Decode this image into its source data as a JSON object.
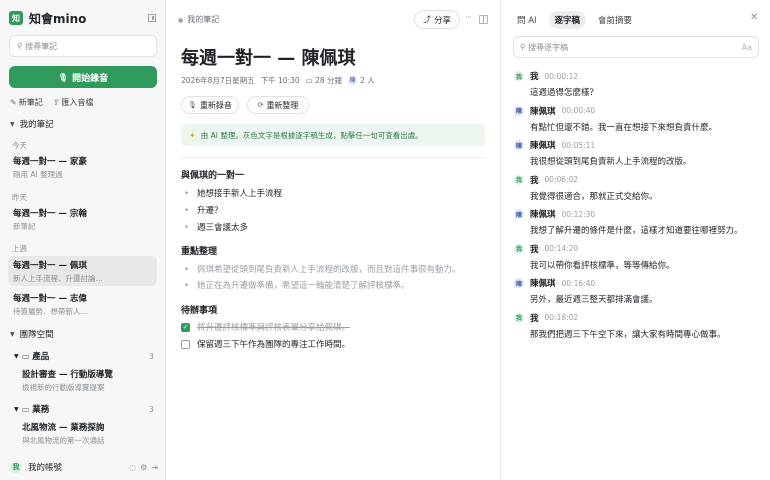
{
  "sidebar": {
    "brand_icon": "知",
    "brand_name": "知會mino",
    "search_placeholder": "搜尋筆記",
    "record_label": "開始錄音",
    "new_note": "新筆記",
    "import_audio": "匯入音檔",
    "my_notes": "我的筆記",
    "groups": [
      {
        "label": "今天",
        "items": [
          {
            "title": "每週一對一 — 家豪",
            "sub": "剛用 AI 整理過"
          }
        ]
      },
      {
        "label": "昨天",
        "items": [
          {
            "title": "每週一對一 — 宗翰",
            "sub": "新筆記"
          }
        ]
      },
      {
        "label": "上週",
        "items": [
          {
            "title": "每週一對一 — 佩琪",
            "sub": "新人上手流程、升遷討論…"
          },
          {
            "title": "每週一對一 — 志偉",
            "sub": "待簽屬勞、想帶新人…"
          }
        ]
      }
    ],
    "team_space": "團隊空間",
    "folders": [
      {
        "name": "產品",
        "count": "3",
        "items": [
          {
            "title": "設計審查 — 行動版導覽",
            "sub": "檢視新的行動版導覽提案"
          }
        ]
      },
      {
        "name": "業務",
        "count": "3",
        "items": [
          {
            "title": "北風物流 — 業務探詢",
            "sub": "與北風物流的第一次通話"
          }
        ]
      }
    ],
    "account_avatar": "我",
    "account_label": "我的帳號"
  },
  "main": {
    "breadcrumb": "我的筆記",
    "share_label": "分享",
    "title": "每週一對一 — 陳佩琪",
    "meta": {
      "date": "2026年8月7日星期五",
      "time": "下午 10:30",
      "duration": "28 分鐘",
      "people_icon": "陳",
      "people": "2 人"
    },
    "re_record": "重新錄音",
    "re_organize": "重新整理",
    "ai_banner": "由 AI 整理。灰色文字是根據逐字稿生成，點擊任一句可查看出處。",
    "section1_title": "與佩琪的一對一",
    "section1_items": [
      "她想接手新人上手流程",
      "升遷？",
      "週三會議太多"
    ],
    "section2_title": "重點整理",
    "section2_items": [
      "佩琪希望從頭到尾負責新人上手流程的改版，而且對這件事很有動力。",
      "她正在為升遷做準備，希望這一輪能清楚了解評核標準。"
    ],
    "section3_title": "待辦事項",
    "todos": [
      {
        "text": "將升遷評核標準與評核表單分享給佩琪。",
        "done": true
      },
      {
        "text": "保留週三下午作為團隊的專注工作時間。",
        "done": false
      }
    ]
  },
  "right": {
    "tabs": [
      "問 AI",
      "逐字稿",
      "會前摘要"
    ],
    "active_tab": 1,
    "search_placeholder": "搜尋逐字稿",
    "aa_label": "Aa",
    "transcript": [
      {
        "avatar": "我",
        "speaker": "我",
        "time": "00:00:12",
        "text": "這週過得怎麼樣？",
        "me": true
      },
      {
        "avatar": "陳",
        "speaker": "陳佩琪",
        "time": "00:00:40",
        "text": "有點忙但還不錯。我一直在想接下來想負責什麼。",
        "me": false
      },
      {
        "avatar": "陳",
        "speaker": "陳佩琪",
        "time": "00:05:11",
        "text": "我很想從頭到尾負責新人上手流程的改版。",
        "me": false
      },
      {
        "avatar": "我",
        "speaker": "我",
        "time": "00:06:02",
        "text": "我覺得很適合，那就正式交給你。",
        "me": true
      },
      {
        "avatar": "陳",
        "speaker": "陳佩琪",
        "time": "00:12:30",
        "text": "我想了解升遷的條件是什麼，這樣才知道要往哪裡努力。",
        "me": false
      },
      {
        "avatar": "我",
        "speaker": "我",
        "time": "00:14:20",
        "text": "我可以帶你看評核標準，等等傳給你。",
        "me": true
      },
      {
        "avatar": "陳",
        "speaker": "陳佩琪",
        "time": "00:16:40",
        "text": "另外，最近週三整天都排滿會議。",
        "me": false
      },
      {
        "avatar": "我",
        "speaker": "我",
        "time": "00:18:02",
        "text": "那我們把週三下午空下來，讓大家有時間專心做事。",
        "me": true
      }
    ]
  }
}
